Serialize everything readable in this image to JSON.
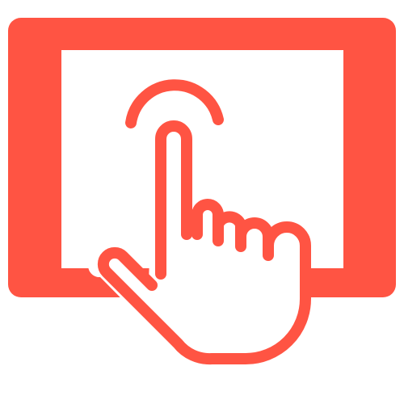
{
  "icon": {
    "name": "tablet-touch-icon",
    "primary_color": "#FF5443",
    "background_color": "#FFFFFF"
  }
}
